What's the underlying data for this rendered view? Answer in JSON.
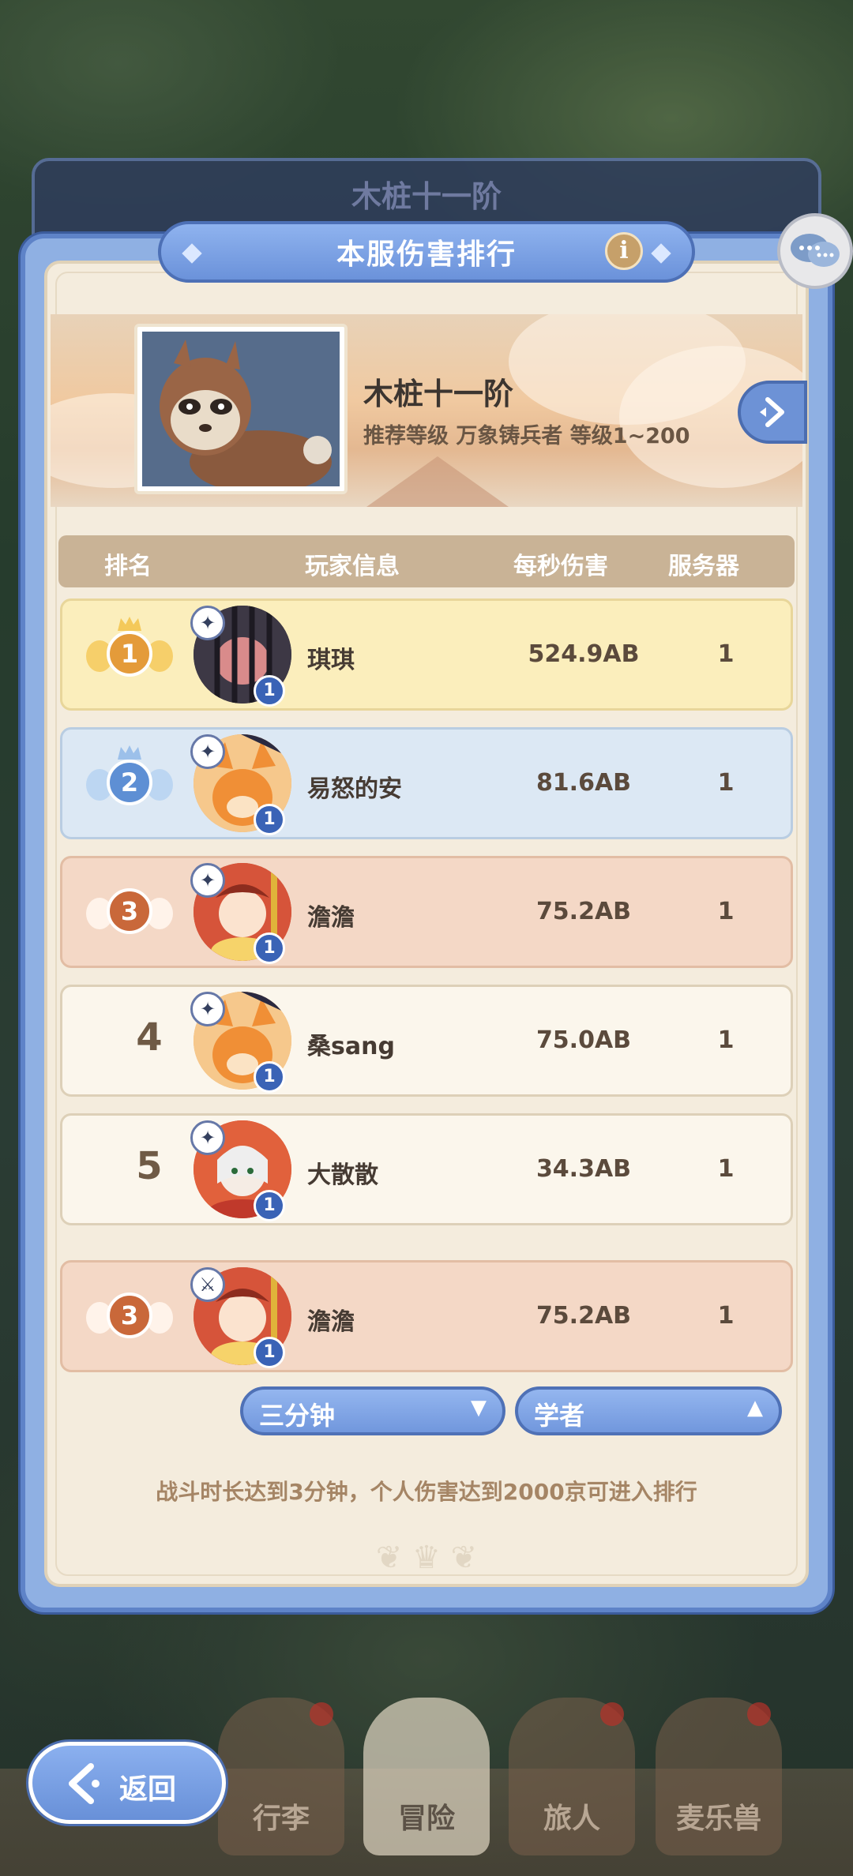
{
  "background_tab": {
    "title": "木桩十一阶"
  },
  "header": {
    "title": "本服伤害排行",
    "info_icon": "i"
  },
  "boss": {
    "name": "木桩十一阶",
    "subtitle": "推荐等级 万象铸兵者 等级1~200"
  },
  "table": {
    "columns": [
      "排名",
      "玩家信息",
      "每秒伤害",
      "服务器"
    ],
    "rows": [
      {
        "rank": "1",
        "name": "琪琪",
        "dps": "524.9AB",
        "server": "1",
        "level": "1",
        "style": "gold"
      },
      {
        "rank": "2",
        "name": "易怒的安",
        "dps": "81.6AB",
        "server": "1",
        "level": "1",
        "style": "blue"
      },
      {
        "rank": "3",
        "name": "澹澹",
        "dps": "75.2AB",
        "server": "1",
        "level": "1",
        "style": "bronze"
      },
      {
        "rank": "4",
        "name": "桑sang",
        "dps": "75.0AB",
        "server": "1",
        "level": "1",
        "style": "plain"
      },
      {
        "rank": "5",
        "name": "大散散",
        "dps": "34.3AB",
        "server": "1",
        "level": "1",
        "style": "plain"
      }
    ],
    "my_row": {
      "rank": "3",
      "name": "澹澹",
      "dps": "75.2AB",
      "server": "1",
      "level": "1",
      "style": "bronze"
    }
  },
  "filters": {
    "duration": {
      "selected": "三分钟"
    },
    "class": {
      "selected": "学者"
    }
  },
  "note": "战斗时长达到3分钟，个人伤害达到2000京可进入排行",
  "bottom_nav": {
    "items": [
      "行李",
      "冒险",
      "旅人",
      "麦乐兽"
    ],
    "back_label": "返回"
  },
  "colors": {
    "gold_row": "#fbeebc",
    "blue_row": "#dce8f4",
    "bronze_row": "#f4d8c6",
    "plain_row": "#fbf6ec",
    "accent_blue": "#6b92da"
  }
}
